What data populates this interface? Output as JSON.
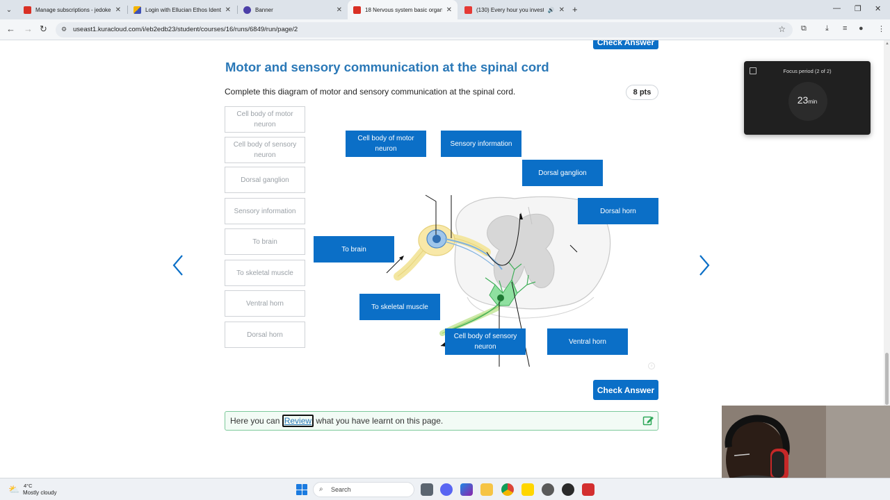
{
  "browser": {
    "tabs": [
      {
        "title": "Manage subscriptions - jedoke",
        "favicon_color": "#d93025"
      },
      {
        "title": "Login with Ellucian Ethos Identi",
        "favicon_color": "#3f51b5"
      },
      {
        "title": "Banner",
        "favicon_color": "#4b3fa8"
      },
      {
        "title": "18 Nervous system basic organ",
        "favicon_color": "#d93025"
      },
      {
        "title": "(130) Every hour you invest",
        "favicon_color": "#e53935"
      }
    ],
    "active_tab_index": 3,
    "url": "useast1.kuracloud.com/i/eb2edb23/student/courses/16/runs/6849/run/page/2"
  },
  "question": {
    "top_button_label": "Check Answer",
    "title": "Motor and sensory communication at the spinal cord",
    "prompt": "Complete this diagram of motor and sensory communication at the spinal cord.",
    "points": "8 pts",
    "word_bank": [
      "Cell body of motor neuron",
      "Cell body  of sensory neuron",
      "Dorsal ganglion",
      "Sensory information",
      "To brain",
      "To skeletal muscle",
      "Ventral horn",
      "Dorsal horn"
    ],
    "placed_labels": {
      "cell_body_motor": "Cell body of motor neuron",
      "sensory_info": "Sensory information",
      "dorsal_ganglion": "Dorsal ganglion",
      "dorsal_horn": "Dorsal horn",
      "to_brain": "To brain",
      "to_skeletal_muscle": "To skeletal muscle",
      "cell_body_sensory": "Cell body  of sensory neuron",
      "ventral_horn": "Ventral horn"
    },
    "check_button_label": "Check Answer",
    "review": {
      "before": "Here you can ",
      "link": "Review",
      "after": " what you have learnt on this page."
    }
  },
  "focus_widget": {
    "title": "Focus period (2 of 2)",
    "minutes": "23",
    "unit": "min"
  },
  "taskbar": {
    "temperature": "4°C",
    "weather": "Mostly cloudy",
    "search_label": "Search"
  },
  "colors": {
    "accent": "#0b6fc7",
    "title_blue": "#2a78b7",
    "review_border": "#7cc99a"
  }
}
